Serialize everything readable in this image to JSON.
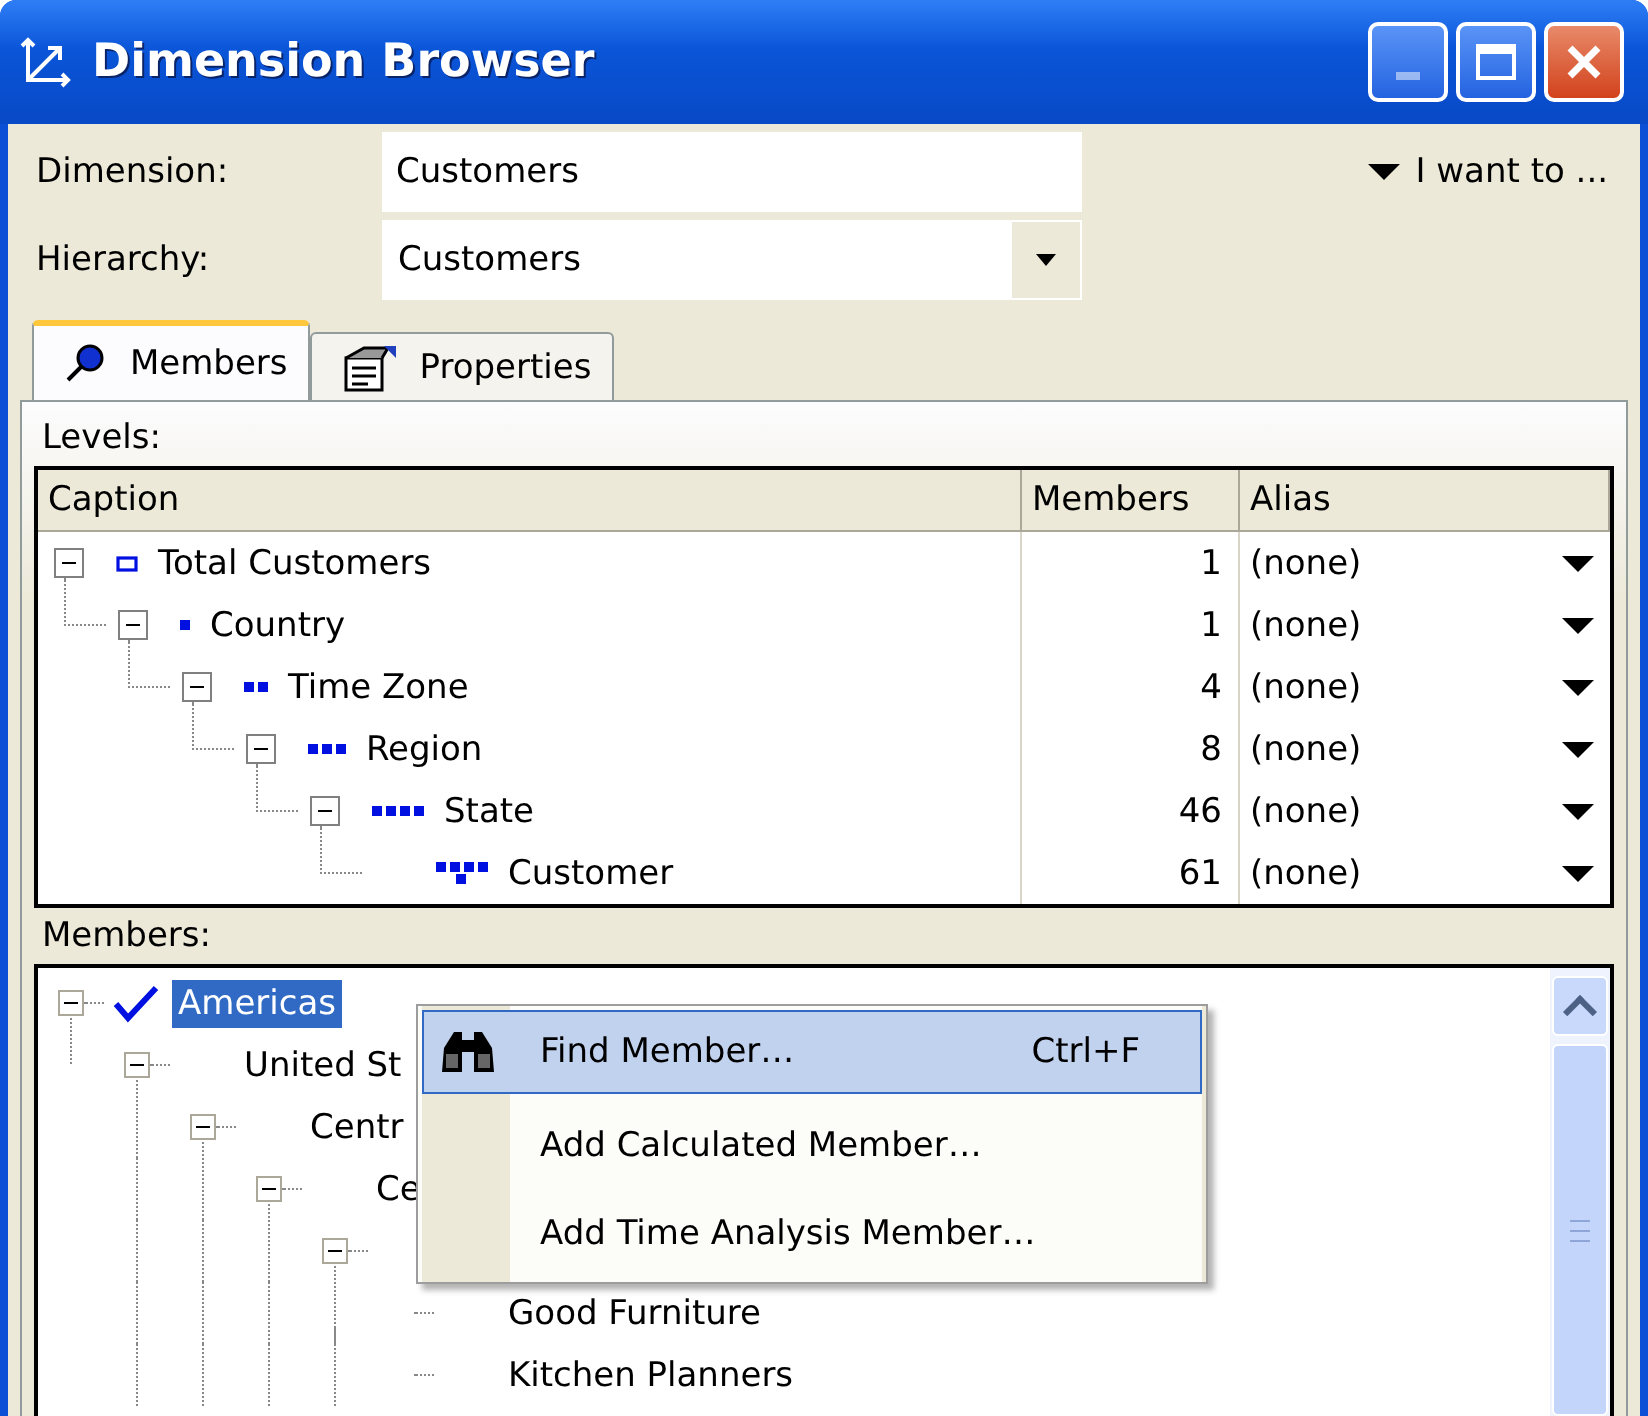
{
  "window": {
    "title": "Dimension Browser"
  },
  "dimension": {
    "label": "Dimension:",
    "value": "Customers"
  },
  "hierarchy": {
    "label": "Hierarchy:",
    "value": "Customers"
  },
  "action_menu": {
    "label": "I want to ..."
  },
  "tabs": [
    {
      "label": "Members",
      "selected": true
    },
    {
      "label": "Properties",
      "selected": false
    }
  ],
  "levels": {
    "label": "Levels:",
    "columns": [
      "Caption",
      "Members",
      "Alias"
    ],
    "rows": [
      {
        "caption": "Total Customers",
        "members": "1",
        "alias": "(none)",
        "expanded": true,
        "children": [
          {
            "caption": "Country",
            "members": "1",
            "alias": "(none)",
            "expanded": true,
            "children": [
              {
                "caption": "Time Zone",
                "members": "4",
                "alias": "(none)",
                "expanded": true,
                "children": [
                  {
                    "caption": "Region",
                    "members": "8",
                    "alias": "(none)",
                    "expanded": true,
                    "children": [
                      {
                        "caption": "State",
                        "members": "46",
                        "alias": "(none)",
                        "expanded": true,
                        "children": [
                          {
                            "caption": "Customer",
                            "members": "61",
                            "alias": "(none)"
                          }
                        ]
                      }
                    ]
                  }
                ]
              }
            ]
          }
        ]
      }
    ]
  },
  "members": {
    "label": "Members:",
    "tree": [
      {
        "label": "Americas",
        "selected": true,
        "checked": true,
        "expanded": true,
        "children": [
          {
            "label": "United St",
            "selected": false,
            "checked": false,
            "expanded": true,
            "children": [
              {
                "label": "Centr",
                "selected": false,
                "checked": false,
                "expanded": true,
                "children": [
                  {
                    "label": "Ce",
                    "selected": false,
                    "checked": false,
                    "expanded": true,
                    "children": [
                      {
                        "expanded": true,
                        "children": [
                          {
                            "label": "Good Furniture",
                            "selected": false,
                            "checked": false
                          },
                          {
                            "label": "Kitchen Planners",
                            "selected": false,
                            "checked": false
                          }
                        ]
                      }
                    ]
                  }
                ]
              }
            ]
          }
        ]
      }
    ]
  },
  "context_menu": {
    "items": [
      {
        "label": "Find Member…",
        "shortcut": "Ctrl+F",
        "selected": true
      },
      {
        "label": "Add Calculated Member…",
        "selected": false
      },
      {
        "label": "Add Time Analysis Member…",
        "selected": false
      }
    ]
  }
}
